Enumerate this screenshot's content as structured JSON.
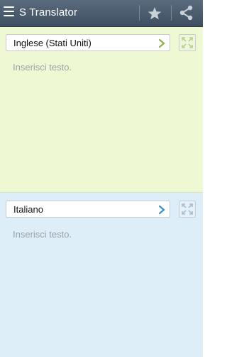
{
  "app": {
    "title": "S Translator"
  },
  "toolbar": {
    "menu_icon": "hamburger-menu-icon",
    "favorite_icon": "star-icon",
    "share_icon": "share-icon"
  },
  "source": {
    "language": "Inglese (Stati Uniti)",
    "placeholder": "Inserisci testo.",
    "text": "",
    "accent_color": "#8fb04a"
  },
  "target": {
    "language": "Italiano",
    "placeholder": "Inserisci testo.",
    "text": "",
    "accent_color": "#3a8fd0"
  },
  "colors": {
    "appbar": "#4a5a6c",
    "source_bg": "#eef8d3",
    "target_bg": "#ddeef9"
  }
}
